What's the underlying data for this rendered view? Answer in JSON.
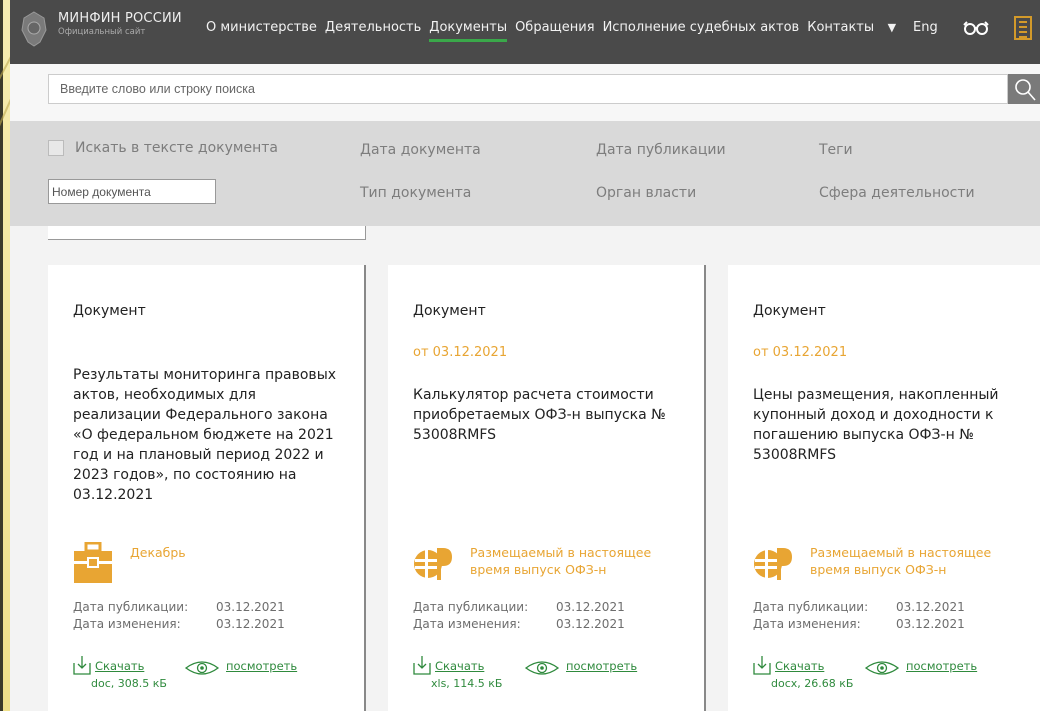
{
  "header": {
    "brand_title": "МИНФИН РОССИИ",
    "brand_subtitle": "Официальный сайт",
    "nav": [
      "О министерстве",
      "Деятельность",
      "Документы",
      "Обращения",
      "Исполнение судебных актов",
      "Контакты"
    ],
    "active_nav": "Документы",
    "lang": "Eng",
    "icons": [
      "emblem-icon",
      "chevron-down-icon",
      "glasses-icon",
      "document-icon"
    ]
  },
  "search": {
    "placeholder": "Введите слово или строку поиска",
    "icon": "search-icon"
  },
  "filters": {
    "search_in_text": "Искать в тексте документа",
    "document_date": "Дата документа",
    "publication_date": "Дата публикации",
    "tags": "Теги",
    "doc_number_placeholder": "Номер документа",
    "doc_type": "Тип документа",
    "authority": "Орган власти",
    "sphere": "Сфера деятельности"
  },
  "colors": {
    "accent": "#e8a533",
    "link": "#2f8a3d",
    "topbar": "#4a4a4a",
    "active_underline": "#3aa84a"
  },
  "cards": [
    {
      "title": "Документ",
      "date": "",
      "description": "Результаты мониторинга правовых актов, необходимых для реализации Федерального закона «О федеральном бюджете на 2021 год и на плановый период 2022 и 2023 годов», по состоянию на 03.12.2021",
      "category": "Декабрь",
      "category_icon": "briefcase-icon",
      "published_label": "Дата публикации:",
      "published": "03.12.2021",
      "modified_label": "Дата изменения:",
      "modified": "03.12.2021",
      "download": "Скачать",
      "file": "doc, 308.5 кБ",
      "view": "посмотреть"
    },
    {
      "title": "Документ",
      "date": "от 03.12.2021",
      "description": "Калькулятор расчета стоимости приобретаемых ОФЗ-н выпуска № 53008RMFS",
      "category": "Размещаемый в настоящее время выпуск ОФЗ-н",
      "category_icon": "ofz-logo-icon",
      "published_label": "Дата публикации:",
      "published": "03.12.2021",
      "modified_label": "Дата изменения:",
      "modified": "03.12.2021",
      "download": "Скачать",
      "file": "xls, 114.5 кБ",
      "view": "посмотреть"
    },
    {
      "title": "Документ",
      "date": "от 03.12.2021",
      "description": "Цены размещения, накопленный купонный доход и доходности к погашению выпуска ОФЗ-н № 53008RMFS",
      "category": "Размещаемый в настоящее время выпуск ОФЗ-н",
      "category_icon": "ofz-logo-icon",
      "published_label": "Дата публикации:",
      "published": "03.12.2021",
      "modified_label": "Дата изменения:",
      "modified": "03.12.2021",
      "download": "Скачать",
      "file": "docx, 26.68 кБ",
      "view": "посмотреть"
    }
  ]
}
